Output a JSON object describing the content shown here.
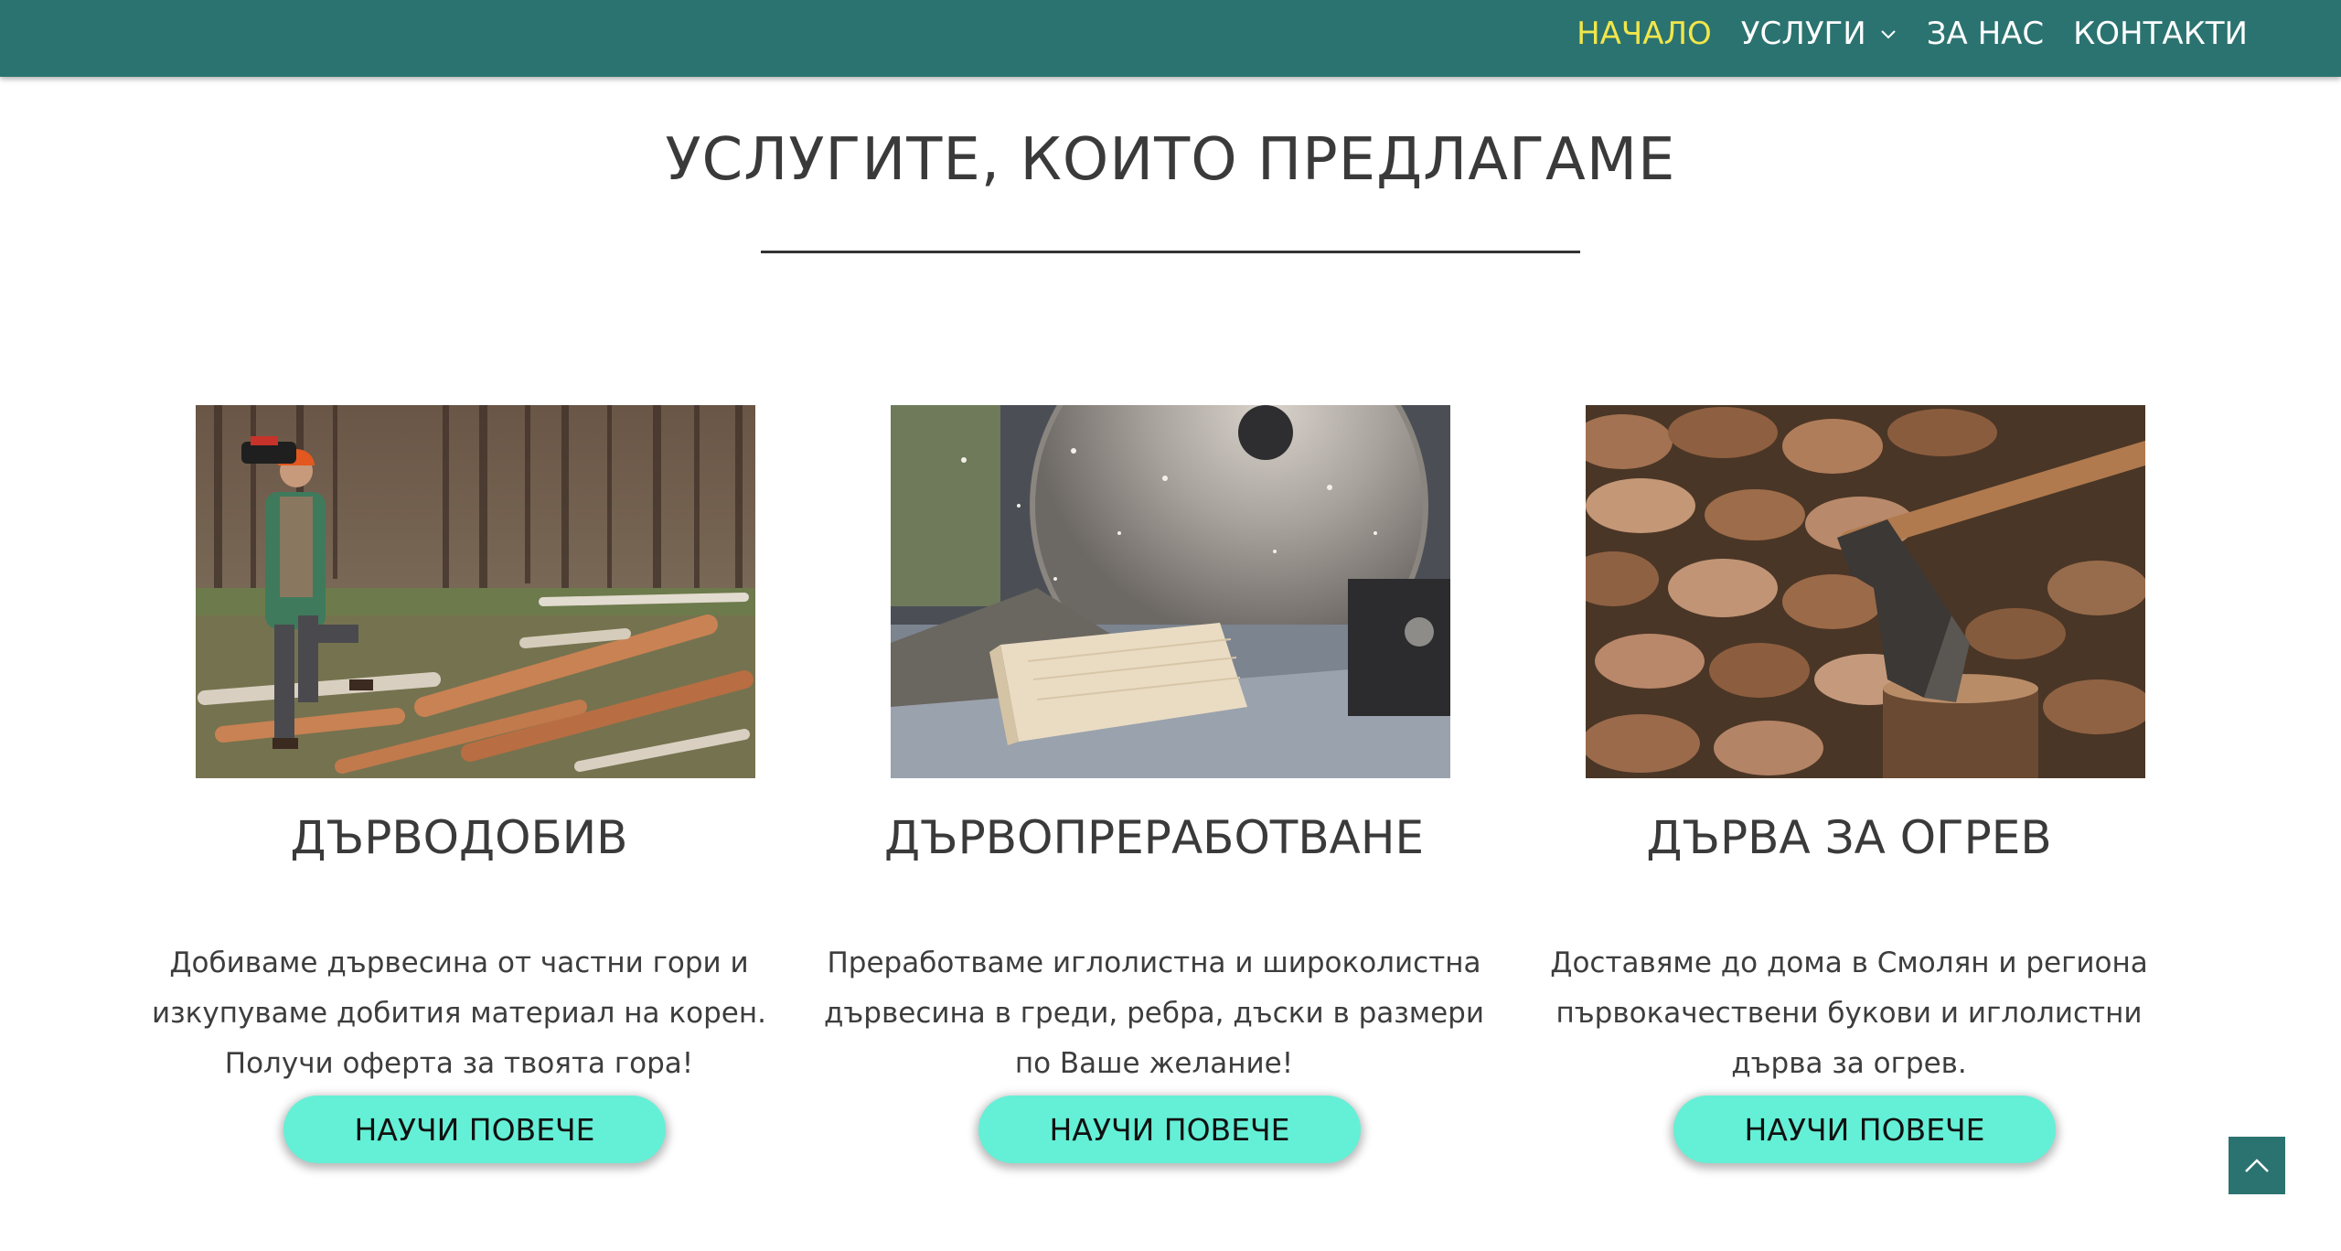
{
  "nav": {
    "items": [
      {
        "label": "НАЧАЛО",
        "active": true
      },
      {
        "label": "УСЛУГИ",
        "has_dropdown": true
      },
      {
        "label": "ЗА НАС"
      },
      {
        "label": "КОНТАКТИ"
      }
    ]
  },
  "services": {
    "title": "УСЛУГИТЕ, КОИТО ПРЕДЛАГАМЕ",
    "cards": [
      {
        "heading": "ДЪРВОДОБИВ",
        "text": "Добиваме дървесина от частни гори и изкупуваме добития материал на корен. Получи оферта за твоята гора!",
        "button": "НАУЧИ ПОВЕЧЕ",
        "image": "lumberjack-with-chainsaw-photo"
      },
      {
        "heading": "ДЪРВОПРЕРАБОТВАНЕ",
        "text": "Преработваме иглолистна и широколистна дървесина в греди, ребра, дъски в размери по Ваше желание!",
        "button": "НАУЧИ ПОВЕЧЕ",
        "image": "circular-saw-cutting-wood-photo"
      },
      {
        "heading": "ДЪРВА ЗА ОГРЕВ",
        "text": "Доставяме до дома в Смолян и региона първокачествени букови и иглолистни дърва за огрев.",
        "button": "НАУЧИ ПОВЕЧЕ",
        "image": "axe-in-stump-firewood-photo"
      }
    ]
  },
  "colors": {
    "header_bg": "#2b7370",
    "nav_active": "#f2e64a",
    "button_bg": "#64f0d6",
    "text": "#3a3a3a"
  },
  "icons": {
    "dropdown": "chevron-down-icon",
    "scroll_top": "chevron-up-icon"
  }
}
